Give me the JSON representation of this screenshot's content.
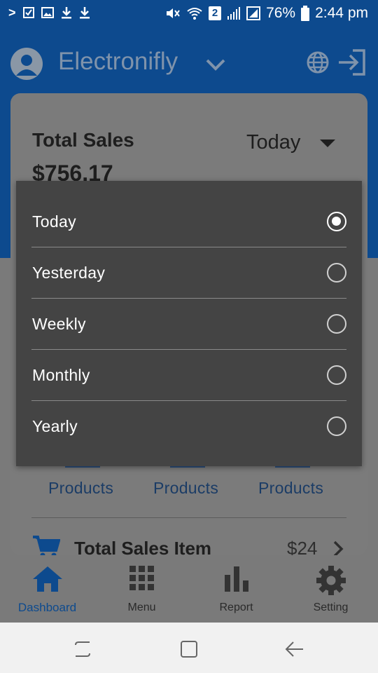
{
  "status_bar": {
    "battery": "76%",
    "time": "2:44 pm",
    "sim_slot": "2"
  },
  "header": {
    "app_title": "Electronifly",
    "icons": [
      "account-circle-icon",
      "chevron-down-icon",
      "globe-icon",
      "logout-icon"
    ]
  },
  "summary": {
    "label": "Total Sales",
    "value": "$756.17",
    "period_selected": "Today"
  },
  "product_links": [
    "Products",
    "Products",
    "Products"
  ],
  "total_sales_item": {
    "label": "Total Sales Item",
    "value": "$24"
  },
  "period_menu": {
    "options": [
      {
        "label": "Today",
        "selected": true
      },
      {
        "label": "Yesterday",
        "selected": false
      },
      {
        "label": "Weekly",
        "selected": false
      },
      {
        "label": "Monthly",
        "selected": false
      },
      {
        "label": "Yearly",
        "selected": false
      }
    ]
  },
  "bottom_nav": {
    "items": [
      {
        "label": "Dashboard",
        "icon": "home-icon",
        "active": true
      },
      {
        "label": "Menu",
        "icon": "grid-icon",
        "active": false
      },
      {
        "label": "Report",
        "icon": "bar-chart-icon",
        "active": false
      },
      {
        "label": "Setting",
        "icon": "gear-icon",
        "active": false
      }
    ]
  },
  "colors": {
    "brand_blue": "#0d4a8e",
    "scrim_grey": "#7a7a7a",
    "menu_dark": "#444444"
  }
}
